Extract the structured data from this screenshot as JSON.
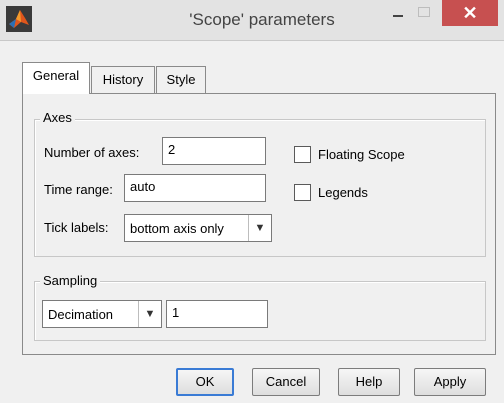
{
  "window": {
    "title": "'Scope' parameters",
    "close_glyph": "✕",
    "colors": {
      "close_button": "#c75050",
      "titlebar": "#e3e3e3"
    }
  },
  "tabs": [
    {
      "label": "General",
      "active": true
    },
    {
      "label": "History",
      "active": false
    },
    {
      "label": "Style",
      "active": false
    }
  ],
  "axes": {
    "group_label": "Axes",
    "number_of_axes_label": "Number of axes:",
    "number_of_axes_value": "2",
    "time_range_label": "Time range:",
    "time_range_value": "auto",
    "tick_labels_label": "Tick labels:",
    "tick_labels_value": "bottom axis only",
    "floating_scope_label": "Floating Scope",
    "floating_scope_checked": false,
    "legends_label": "Legends",
    "legends_checked": false
  },
  "sampling": {
    "group_label": "Sampling",
    "mode_value": "Decimation",
    "factor_value": "1"
  },
  "buttons": {
    "ok": "OK",
    "cancel": "Cancel",
    "help": "Help",
    "apply": "Apply"
  }
}
